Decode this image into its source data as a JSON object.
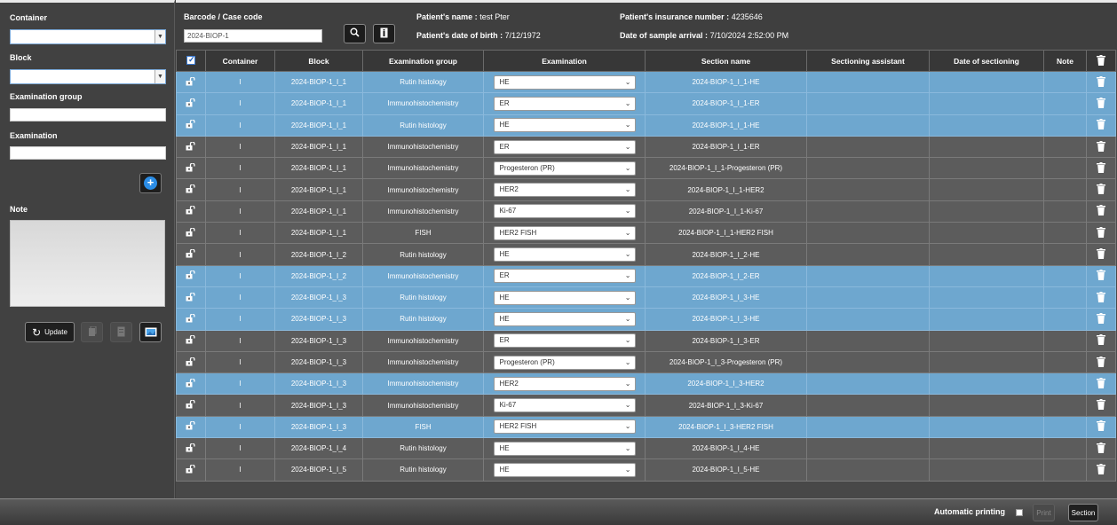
{
  "left_panel": {
    "container_label": "Container",
    "block_label": "Block",
    "examination_group_label": "Examination group",
    "examination_label": "Examination",
    "note_label": "Note",
    "update_label": "Update"
  },
  "header": {
    "barcode_label": "Barcode / Case code",
    "barcode_value": "2024-BIOP-1",
    "patient_name_label": "Patient's name :",
    "patient_name": "test Pter",
    "dob_label": "Patient's date of birth :",
    "dob": "7/12/1972",
    "insurance_label": "Patient's insurance number :",
    "insurance_number": "4235646",
    "arrival_label": "Date of sample arrival :",
    "arrival_date": "7/10/2024 2:52:00 PM"
  },
  "table": {
    "columns": [
      "Container",
      "Block",
      "Examination group",
      "Examination",
      "Section name",
      "Sectioning assistant",
      "Date of sectioning",
      "Note"
    ],
    "rows": [
      {
        "highlight": true,
        "container": "I",
        "block": "2024-BIOP-1_I_1",
        "group": "Rutin histology",
        "exam": "HE",
        "section": "2024-BIOP-1_I_1-HE"
      },
      {
        "highlight": true,
        "container": "I",
        "block": "2024-BIOP-1_I_1",
        "group": "Immunohistochemistry",
        "exam": "ER",
        "section": "2024-BIOP-1_I_1-ER"
      },
      {
        "highlight": true,
        "container": "I",
        "block": "2024-BIOP-1_I_1",
        "group": "Rutin histology",
        "exam": "HE",
        "section": "2024-BIOP-1_I_1-HE"
      },
      {
        "highlight": false,
        "container": "I",
        "block": "2024-BIOP-1_I_1",
        "group": "Immunohistochemistry",
        "exam": "ER",
        "section": "2024-BIOP-1_I_1-ER"
      },
      {
        "highlight": false,
        "container": "I",
        "block": "2024-BIOP-1_I_1",
        "group": "Immunohistochemistry",
        "exam": "Progesteron (PR)",
        "section": "2024-BIOP-1_I_1-Progesteron (PR)"
      },
      {
        "highlight": false,
        "container": "I",
        "block": "2024-BIOP-1_I_1",
        "group": "Immunohistochemistry",
        "exam": "HER2",
        "section": "2024-BIOP-1_I_1-HER2"
      },
      {
        "highlight": false,
        "container": "I",
        "block": "2024-BIOP-1_I_1",
        "group": "Immunohistochemistry",
        "exam": "Ki-67",
        "section": "2024-BIOP-1_I_1-Ki-67"
      },
      {
        "highlight": false,
        "container": "I",
        "block": "2024-BIOP-1_I_1",
        "group": "FISH",
        "exam": "HER2 FISH",
        "section": "2024-BIOP-1_I_1-HER2 FISH"
      },
      {
        "highlight": false,
        "container": "I",
        "block": "2024-BIOP-1_I_2",
        "group": "Rutin histology",
        "exam": "HE",
        "section": "2024-BIOP-1_I_2-HE"
      },
      {
        "highlight": true,
        "container": "I",
        "block": "2024-BIOP-1_I_2",
        "group": "Immunohistochemistry",
        "exam": "ER",
        "section": "2024-BIOP-1_I_2-ER"
      },
      {
        "highlight": true,
        "container": "I",
        "block": "2024-BIOP-1_I_3",
        "group": "Rutin histology",
        "exam": "HE",
        "section": "2024-BIOP-1_I_3-HE"
      },
      {
        "highlight": true,
        "container": "I",
        "block": "2024-BIOP-1_I_3",
        "group": "Rutin histology",
        "exam": "HE",
        "section": "2024-BIOP-1_I_3-HE"
      },
      {
        "highlight": false,
        "container": "I",
        "block": "2024-BIOP-1_I_3",
        "group": "Immunohistochemistry",
        "exam": "ER",
        "section": "2024-BIOP-1_I_3-ER"
      },
      {
        "highlight": false,
        "container": "I",
        "block": "2024-BIOP-1_I_3",
        "group": "Immunohistochemistry",
        "exam": "Progesteron (PR)",
        "section": "2024-BIOP-1_I_3-Progesteron (PR)"
      },
      {
        "highlight": true,
        "container": "I",
        "block": "2024-BIOP-1_I_3",
        "group": "Immunohistochemistry",
        "exam": "HER2",
        "section": "2024-BIOP-1_I_3-HER2"
      },
      {
        "highlight": false,
        "container": "I",
        "block": "2024-BIOP-1_I_3",
        "group": "Immunohistochemistry",
        "exam": "Ki-67",
        "section": "2024-BIOP-1_I_3-Ki-67"
      },
      {
        "highlight": true,
        "container": "I",
        "block": "2024-BIOP-1_I_3",
        "group": "FISH",
        "exam": "HER2 FISH",
        "section": "2024-BIOP-1_I_3-HER2 FISH"
      },
      {
        "highlight": false,
        "container": "I",
        "block": "2024-BIOP-1_I_4",
        "group": "Rutin histology",
        "exam": "HE",
        "section": "2024-BIOP-1_I_4-HE"
      },
      {
        "highlight": false,
        "container": "I",
        "block": "2024-BIOP-1_I_5",
        "group": "Rutin histology",
        "exam": "HE",
        "section": "2024-BIOP-1_I_5-HE"
      }
    ]
  },
  "footer": {
    "auto_print_label": "Automatic printing",
    "print_label": "Print",
    "section_label": "Section"
  },
  "colors": {
    "row_highlight": "#6ea7cf",
    "row_normal": "#5c5c5c",
    "accent": "#2b8de6"
  }
}
